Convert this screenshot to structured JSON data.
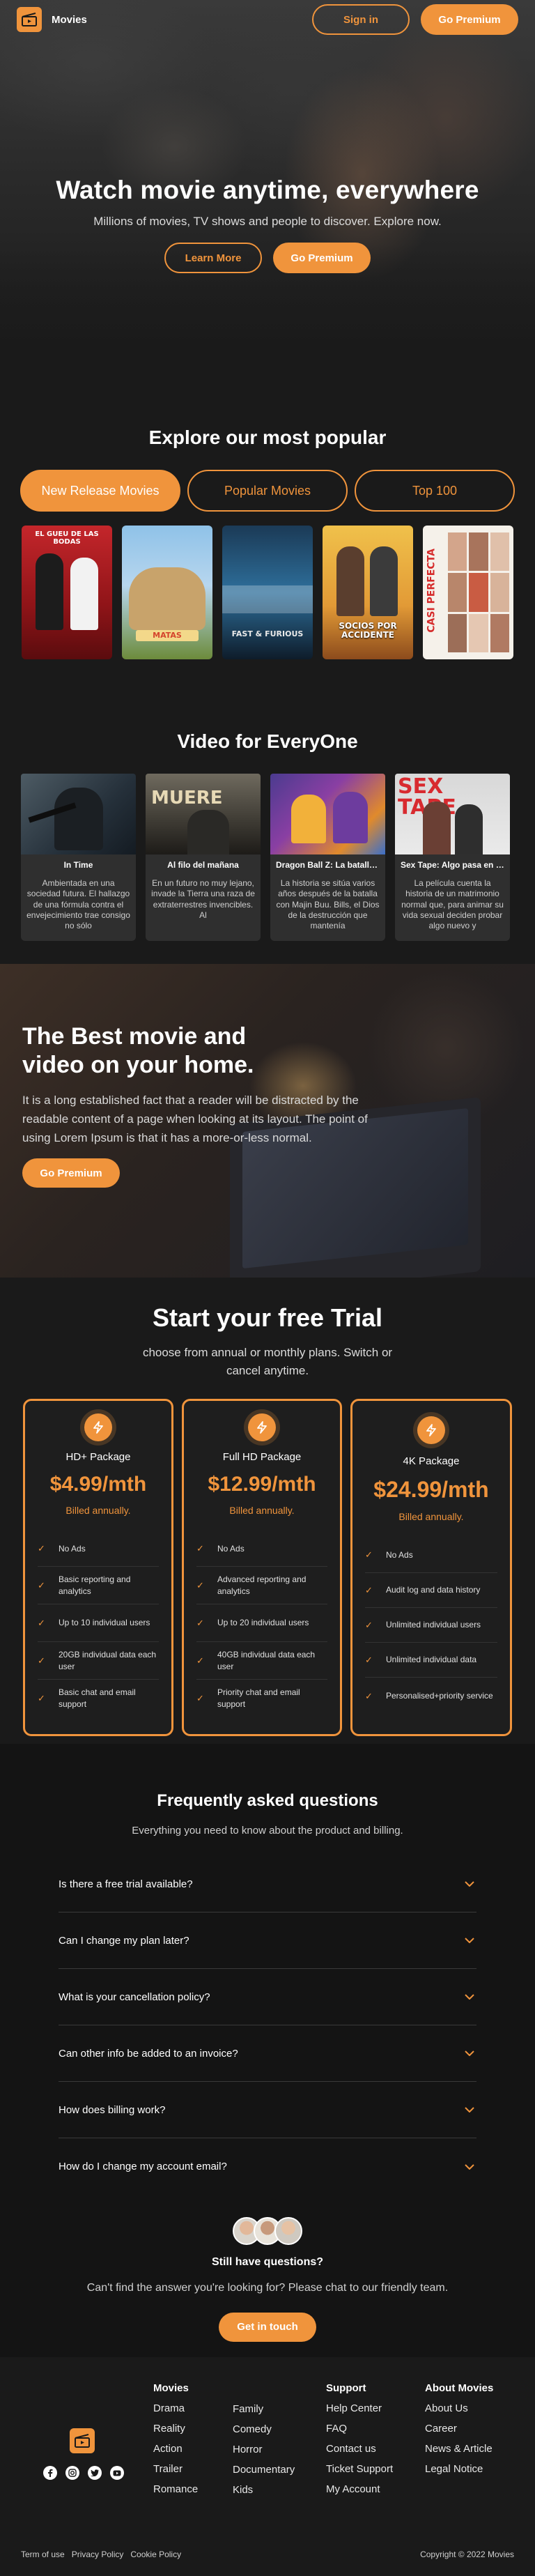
{
  "brand": {
    "name": "Movies",
    "accent": "#f0943c",
    "logo_icon": "clapperboard-icon"
  },
  "nav": {
    "signin_label": "Sign in",
    "premium_label": "Go Premium"
  },
  "hero": {
    "title": "Watch movie anytime, everywhere",
    "subtitle": "Millions of movies, TV shows and people to discover. Explore now.",
    "learn_label": "Learn More",
    "premium_label": "Go Premium"
  },
  "popular": {
    "title": "Explore our most popular",
    "tabs": [
      "New Release Movies",
      "Popular Movies",
      "Top 100"
    ],
    "active_tab": "New Release Movies",
    "posters": [
      {
        "text": "EL GUEU DE LAS BODAS"
      },
      {
        "text": "MATAS"
      },
      {
        "text": "FAST & FURIOUS"
      },
      {
        "text": "SOCIOS POR ACCIDENTE"
      },
      {
        "text": "CASI PERFECTA"
      }
    ]
  },
  "video": {
    "title": "Video for EveryOne",
    "cards": [
      {
        "thumb_text": "",
        "title": "In Time",
        "desc": "Ambientada en una sociedad futura. El hallazgo de una fórmula contra el envejecimiento trae consigo no sólo"
      },
      {
        "thumb_text": "MUERE",
        "title": "Al filo del mañana",
        "desc": "En un futuro no muy lejano, invade la Tierra una raza de extraterrestres invencibles. Al"
      },
      {
        "thumb_text": "",
        "title": "Dragon Ball Z: La batalla de los dioses",
        "desc": "La historia se sitúa varios años después de la batalla con Majin Buu. Bills, el Dios de la destrucción que mantenía"
      },
      {
        "thumb_text": "SEX TAPE",
        "title": "Sex Tape: Algo pasa en la nube",
        "desc": "La película cuenta la historia de un matrimonio normal que, para animar su vida sexual deciden probar algo nuevo y"
      }
    ]
  },
  "best": {
    "title_line1": "The Best movie and",
    "title_line2": "video on your home.",
    "text": "It is a long established fact that a reader will be distracted by the readable content of a page when looking at its layout. The point of using Lorem Ipsum is that it has a more-or-less normal.",
    "button_label": "Go Premium"
  },
  "trial": {
    "title": "Start your free Trial",
    "subtitle_line1": "choose from annual or monthly plans. Switch or",
    "subtitle_line2": "cancel anytime.",
    "plans": [
      {
        "name": "HD+ Package",
        "price": "$4.99/mth",
        "billed": "Billed annually.",
        "icon": "bolt-icon",
        "features": [
          "No Ads",
          "Basic reporting and analytics",
          "Up to 10 individual users",
          "20GB individual data each user",
          "Basic chat and email support"
        ]
      },
      {
        "name": "Full HD Package",
        "price": "$12.99/mth",
        "billed": "Billed annually.",
        "icon": "bolt-icon",
        "features": [
          "No Ads",
          "Advanced reporting and analytics",
          "Up to 20 individual users",
          "40GB individual data each user",
          "Priority chat and email support"
        ]
      },
      {
        "name": "4K Package",
        "price": "$24.99/mth",
        "billed": "Billed annually.",
        "icon": "bolt-icon",
        "features": [
          "No Ads",
          "Audit log and data history",
          "Unlimited individual users",
          "Unlimited individual data",
          "Personalised+priority service"
        ]
      }
    ]
  },
  "faq": {
    "title": "Frequently asked questions",
    "subtitle": "Everything you need to know about the product and billing.",
    "questions": [
      "Is there a free trial available?",
      "Can I change my plan later?",
      "What is your cancellation policy?",
      "Can other info be added to an invoice?",
      "How does billing work?",
      "How do I change my account email?"
    ],
    "still_title": "Still have questions?",
    "still_text": "Can't find the answer you're looking for? Please chat to our friendly team.",
    "touch_label": "Get in touch"
  },
  "footer": {
    "movies_heading": "Movies",
    "movies_col1": [
      "Drama",
      "Reality",
      "Action",
      "Trailer",
      "Romance"
    ],
    "movies_col2": [
      "Family",
      "Comedy",
      "Horror",
      "Documentary",
      "Kids"
    ],
    "support_heading": "Support",
    "support_links": [
      "Help Center",
      "FAQ",
      "Contact us",
      "Ticket Support",
      "My Account"
    ],
    "about_heading": "About Movies",
    "about_links": [
      "About Us",
      "Career",
      "News & Article",
      "Legal Notice"
    ],
    "legal_links": [
      "Term of use",
      "Privacy Policy",
      "Cookie Policy"
    ],
    "copyright": "Copyright © 2022 Movies",
    "social_icons": [
      "facebook-icon",
      "instagram-icon",
      "twitter-icon",
      "youtube-icon"
    ]
  }
}
